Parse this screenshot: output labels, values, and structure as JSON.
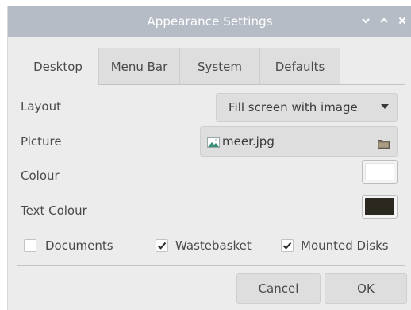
{
  "window": {
    "title": "Appearance Settings"
  },
  "titlebar_icons": [
    "chevron-down-icon",
    "chevron-up-icon",
    "close-icon"
  ],
  "tabs": [
    {
      "label": "Desktop",
      "active": true
    },
    {
      "label": "Menu Bar",
      "active": false
    },
    {
      "label": "System",
      "active": false
    },
    {
      "label": "Defaults",
      "active": false
    }
  ],
  "desktop": {
    "layout_label": "Layout",
    "layout_value": "Fill screen with image",
    "picture_label": "Picture",
    "picture_value": "meer.jpg",
    "colour_label": "Colour",
    "colour_value": "#ffffff",
    "text_colour_label": "Text Colour",
    "text_colour_value": "#2b2820",
    "checkboxes": [
      {
        "label": "Documents",
        "checked": false
      },
      {
        "label": "Wastebasket",
        "checked": true
      },
      {
        "label": "Mounted Disks",
        "checked": true
      }
    ]
  },
  "buttons": {
    "cancel": "Cancel",
    "ok": "OK"
  },
  "colors": {
    "titlebar": "#b6bcc6",
    "background": "#ececec"
  }
}
